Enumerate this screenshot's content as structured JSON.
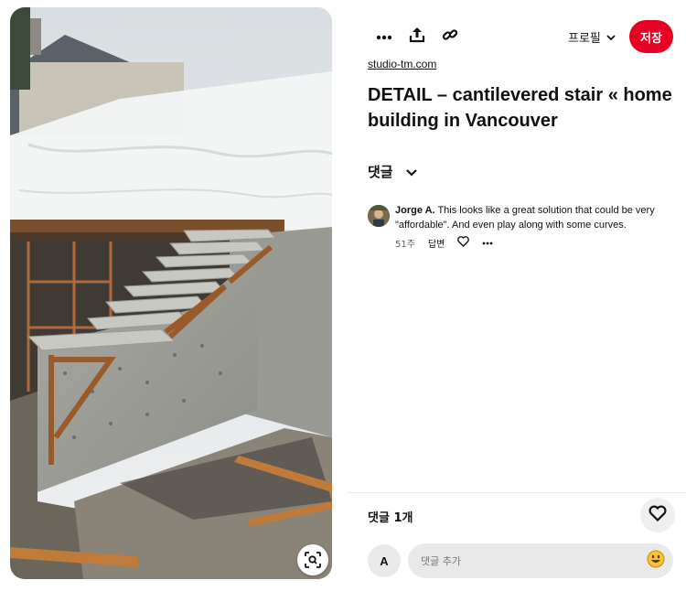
{
  "pin": {
    "source": "studio-tm.com",
    "title": "DETAIL – cantilevered stair « home building in Vancouver",
    "image_alt": "Concrete cantilevered stair under construction with plastic sheeting"
  },
  "toolbar": {
    "more_icon": "more-horizontal-icon",
    "share_icon": "share-upload-icon",
    "link_icon": "link-icon",
    "profile_label": "프로필",
    "save_label": "저장",
    "save_color": "#e60023"
  },
  "comments": {
    "toggle_label": "댓글",
    "items": [
      {
        "author": "Jorge A.",
        "text": " This looks like a great solution that could be very \"affordable\". And even play along with some curves.",
        "age": "51주",
        "reply_label": "답변"
      }
    ],
    "count_label": "댓글 1개",
    "input_placeholder": "댓글 추가",
    "user_initial": "A"
  }
}
